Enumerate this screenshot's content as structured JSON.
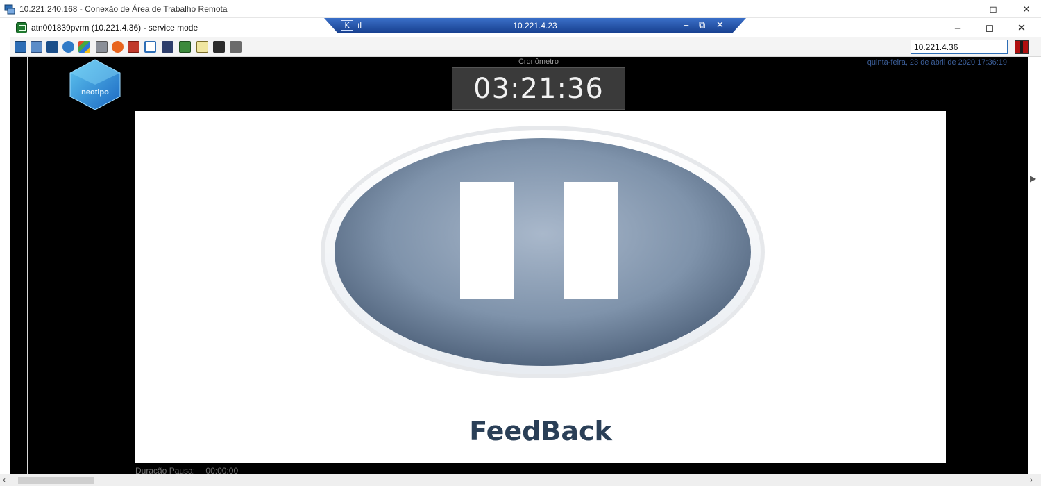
{
  "outer_window": {
    "title": "10.221.240.168 - Conexão de Área de Trabalho Remota",
    "minimize": "–",
    "maximize": "◻",
    "close": "✕"
  },
  "session_window": {
    "title": "atn001839pvrm (10.221.4.36) - service mode",
    "minimize": "–",
    "maximize": "◻",
    "close": "✕"
  },
  "connection_bar": {
    "pin": "K",
    "signal": "ıl",
    "ip": "10.221.4.23",
    "minimize": "–",
    "restore": "⧉",
    "close": "✕",
    "color": "#1e4fa8"
  },
  "toolbar": {
    "icons": [
      "screen-icon",
      "copy-icon",
      "cut-icon",
      "refresh-icon",
      "windows-icon",
      "printer-icon",
      "alert-icon",
      "network-icon",
      "fullscreen-icon",
      "monitor-icon",
      "transfer-icon",
      "notes-icon",
      "settings-icon",
      "chat-icon"
    ],
    "address_value": "10.221.4.36"
  },
  "remote": {
    "logo_text": "neotipo",
    "crono_label": "Cronômetro",
    "crono_time": "03:21:36",
    "datetime": "quinta-feira, 23 de abril de 2020 17:36:19",
    "feedback_label": "FeedBack",
    "pause_label": "Duração Pausa:",
    "pause_value": "00:00:00",
    "accent_color": "#2a3f57"
  },
  "scrollbar": {
    "left_arrow": "‹",
    "right_arrow": "›"
  }
}
